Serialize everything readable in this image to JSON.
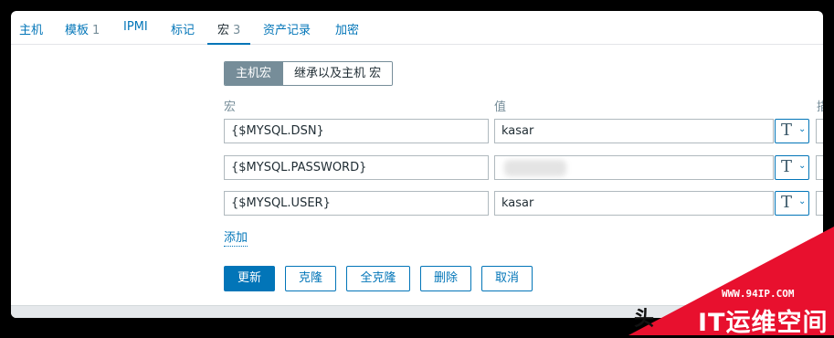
{
  "tabs": [
    {
      "label": "主机",
      "count": ""
    },
    {
      "label": "模板",
      "count": "1"
    },
    {
      "label": "IPMI",
      "count": ""
    },
    {
      "label": "标记",
      "count": ""
    },
    {
      "label": "宏",
      "count": "3"
    },
    {
      "label": "资产记录",
      "count": ""
    },
    {
      "label": "加密",
      "count": ""
    }
  ],
  "active_tab": "宏",
  "macro_mode": {
    "host_macros": "主机宏",
    "inherited": "继承以及主机 宏"
  },
  "columns": {
    "macro": "宏",
    "value": "值",
    "description_partial": "描"
  },
  "macros": [
    {
      "name": "{$MYSQL.DSN}",
      "value": "kasar",
      "type_icon": "T",
      "hidden": false
    },
    {
      "name": "{$MYSQL.PASSWORD}",
      "value": "",
      "type_icon": "T",
      "hidden": true
    },
    {
      "name": "{$MYSQL.USER}",
      "value": "kasar",
      "type_icon": "T",
      "hidden": false
    }
  ],
  "add_link": "添加",
  "buttons": {
    "update": "更新",
    "clone": "克隆",
    "full_clone": "全克隆",
    "delete": "删除",
    "cancel": "取消"
  },
  "watermark": {
    "url": "WWW.94IP.COM",
    "text": "IT运维空间",
    "partial": "头"
  },
  "colors": {
    "accent": "#0275b8",
    "segment_active": "#768d99",
    "watermark": "#e8102e"
  }
}
